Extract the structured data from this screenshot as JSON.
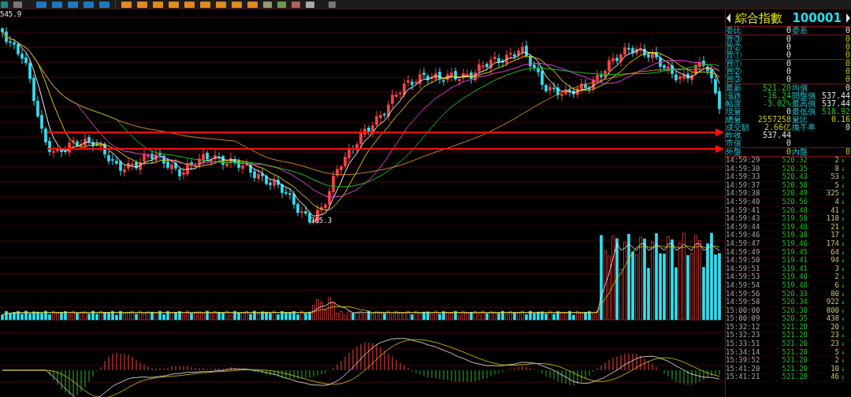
{
  "chart": {
    "high_label": "545.9",
    "low_label": "365.3"
  },
  "quote_header": {
    "name": "綜合指數",
    "code": "100001"
  },
  "order_book": [
    {
      "label": "委比",
      "value": "0",
      "label2": "委差",
      "value2": "0"
    },
    {
      "label": "賣③",
      "value": "0",
      "value2": "0"
    },
    {
      "label": "賣②",
      "value": "0",
      "value2": "0"
    },
    {
      "label": "賣①",
      "value": "0",
      "value2": "0"
    },
    {
      "label": "買①",
      "value": "0",
      "value2": "0"
    },
    {
      "label": "買②",
      "value": "0",
      "value2": "0"
    },
    {
      "label": "買③",
      "value": "0",
      "value2": "0"
    }
  ],
  "stats": [
    {
      "label": "最新",
      "value": "521.20",
      "label2": "均價",
      "value2": "0"
    },
    {
      "label": "漲跌",
      "value": "-16.24",
      "label2": "開盤價",
      "value2": "537.44"
    },
    {
      "label": "幅度",
      "value": "-3.02%",
      "label2": "最高價",
      "value2": "537.44"
    },
    {
      "label": "現量",
      "value": "0",
      "label2": "最低價",
      "value2": "518.92"
    },
    {
      "label": "總量",
      "value": "2557258",
      "label2": "量比",
      "value2": "0.16"
    },
    {
      "label": "成交額",
      "value": "2.66亿",
      "label2": "換手率",
      "value2": "0"
    },
    {
      "label": "昨收",
      "value": "537.44"
    },
    {
      "label": "市值",
      "value": "0"
    }
  ],
  "outer_inner": {
    "label": "外盤",
    "value": "0",
    "label2": "內盤",
    "value2": "0"
  },
  "trades": [
    {
      "time": "14:59:29",
      "price": "520.32",
      "volume": "2",
      "arrow": "↓"
    },
    {
      "time": "14:59:30",
      "price": "520.35",
      "volume": "8",
      "arrow": "↓"
    },
    {
      "time": "14:59:33",
      "price": "520.43",
      "volume": "53",
      "arrow": "↓"
    },
    {
      "time": "14:59:37",
      "price": "520.50",
      "volume": "5",
      "arrow": "↓"
    },
    {
      "time": "14:59:38",
      "price": "520.49",
      "volume": "325",
      "arrow": "↓"
    },
    {
      "time": "14:59:40",
      "price": "520.56",
      "volume": "4",
      "arrow": "↓"
    },
    {
      "time": "14:59:41",
      "price": "520.48",
      "volume": "41",
      "arrow": "↓"
    },
    {
      "time": "14:59:43",
      "price": "519.58",
      "volume": "118",
      "arrow": "↓"
    },
    {
      "time": "14:59:44",
      "price": "519.40",
      "volume": "21",
      "arrow": "↓"
    },
    {
      "time": "14:59:46",
      "price": "519.38",
      "volume": "17",
      "arrow": "↓"
    },
    {
      "time": "14:59:47",
      "price": "519.46",
      "volume": "174",
      "arrow": "↓"
    },
    {
      "time": "14:59:49",
      "price": "519.45",
      "volume": "64",
      "arrow": "↓"
    },
    {
      "time": "14:59:50",
      "price": "519.41",
      "volume": "94",
      "arrow": "↓"
    },
    {
      "time": "14:59:51",
      "price": "519.41",
      "volume": "3",
      "arrow": "↓"
    },
    {
      "time": "14:59:53",
      "price": "519.40",
      "volume": "2",
      "arrow": "↓"
    },
    {
      "time": "14:59:54",
      "price": "519.40",
      "volume": "6",
      "arrow": "↓"
    },
    {
      "time": "14:59:56",
      "price": "520.33",
      "volume": "80",
      "arrow": "↓"
    },
    {
      "time": "14:59:58",
      "price": "520.34",
      "volume": "922",
      "arrow": "↓"
    },
    {
      "time": "15:00:00",
      "price": "520.30",
      "volume": "800",
      "arrow": "↓"
    },
    {
      "time": "15:00:09",
      "price": "520.35",
      "volume": "438",
      "arrow": "↓"
    },
    {
      "time": "15:32:12",
      "price": "521.20",
      "volume": "20",
      "arrow": "↓"
    },
    {
      "time": "15:32:23",
      "price": "521.20",
      "volume": "23",
      "arrow": "↓"
    },
    {
      "time": "15:33:51",
      "price": "521.20",
      "volume": "23",
      "arrow": "↓"
    },
    {
      "time": "15:34:14",
      "price": "521.20",
      "volume": "5",
      "arrow": "↓"
    },
    {
      "time": "15:39:52",
      "price": "521.20",
      "volume": "2",
      "arrow": "↓"
    },
    {
      "time": "15:41:20",
      "price": "521.20",
      "volume": "10",
      "arrow": "↓"
    },
    {
      "time": "15:41:21",
      "price": "521.20",
      "volume": "46",
      "arrow": "↓"
    }
  ]
}
